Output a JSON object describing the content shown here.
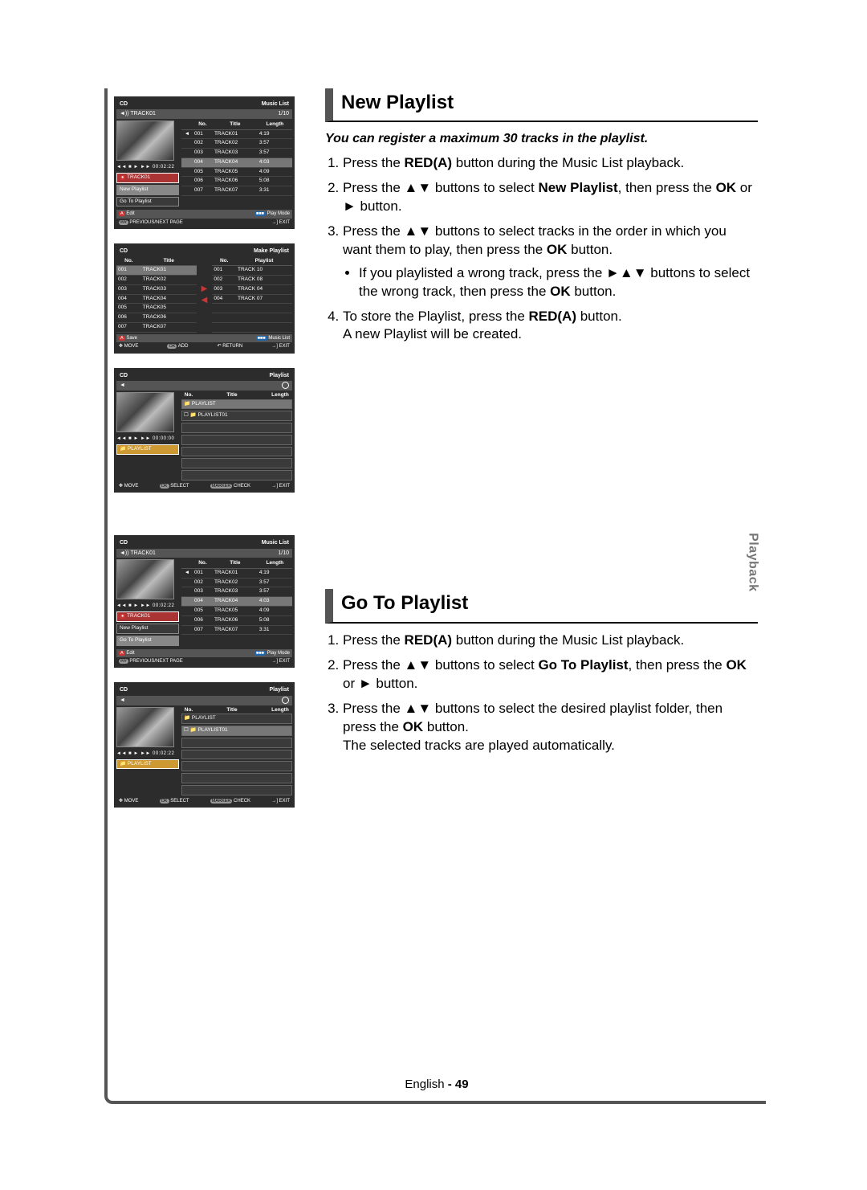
{
  "side_tab": "Playback",
  "footer": {
    "language": "English",
    "dash": " - ",
    "page": "49"
  },
  "section1": {
    "heading": "New Playlist",
    "note": "You can register a maximum 30 tracks in the playlist.",
    "s1_pre": "Press the ",
    "s1_btn": "RED(A)",
    "s1_post": " button during the Music List playback.",
    "s2_pre": "Press the ",
    "s2_arrows": "▲▼",
    "s2_mid": " buttons to select ",
    "s2_target": "New Playlist",
    "s2_mid2": ", then press the ",
    "s2_ok": "OK",
    "s2_or": " or ",
    "s2_play": "►",
    "s2_end": " button.",
    "s3_pre": "Press the ",
    "s3_arrows": "▲▼",
    "s3_mid": " buttons to select tracks in the order in which you want them to play, then press the ",
    "s3_ok": "OK",
    "s3_end": " button.",
    "s3b_pre": "If you playlisted a wrong track, press the ",
    "s3b_arrows": "►▲▼",
    "s3b_mid": " buttons to select the wrong track, then press the ",
    "s3b_ok": "OK",
    "s3b_end": " button.",
    "s4_pre": "To store the Playlist, press the ",
    "s4_btn": "RED(A)",
    "s4_end": " button.",
    "s4_line2": "A new Playlist will be created."
  },
  "section2": {
    "heading": "Go To Playlist",
    "s1_pre": "Press the ",
    "s1_btn": "RED(A)",
    "s1_post": " button during the Music List playback.",
    "s2_pre": "Press the ",
    "s2_arrows": "▲▼",
    "s2_mid": " buttons to select ",
    "s2_target": "Go To Playlist",
    "s2_mid2": ", then press the ",
    "s2_ok": "OK",
    "s2_or": " or ",
    "s2_play": "►",
    "s2_end": " button.",
    "s3_pre": "Press the ",
    "s3_arrows": "▲▼",
    "s3_mid": " buttons to select the desired playlist folder, then press the ",
    "s3_ok": "OK",
    "s3_end": " button.",
    "s3_line2": "The selected tracks are played automatically."
  },
  "shot_musiclist": {
    "title_left": "CD",
    "title_right": "Music List",
    "sub_left": "◄)) TRACK01",
    "sub_right": "1/10",
    "ctl": "◄◄  ■  ►  ►►   00:02:22",
    "btn_current": "TRACK01",
    "opt_new": "New Playlist",
    "opt_goto": "Go To Playlist",
    "th_no": "No.",
    "th_title": "Title",
    "th_len": "Length",
    "tracks": [
      {
        "no": "001",
        "title": "TRACK01",
        "len": "4:19",
        "playing": true
      },
      {
        "no": "002",
        "title": "TRACK02",
        "len": "3:57"
      },
      {
        "no": "003",
        "title": "TRACK03",
        "len": "3:57"
      },
      {
        "no": "004",
        "title": "TRACK04",
        "len": "4:03",
        "hl": true
      },
      {
        "no": "005",
        "title": "TRACK05",
        "len": "4:09"
      },
      {
        "no": "006",
        "title": "TRACK06",
        "len": "5:08"
      },
      {
        "no": "007",
        "title": "TRACK07",
        "len": "3:31"
      }
    ],
    "strip_edit": "Edit",
    "strip_playmode": "Play Mode",
    "strip_prev": "PREVIOUS/NEXT PAGE",
    "strip_exit": "EXIT"
  },
  "shot_makeplaylist": {
    "title_left": "CD",
    "title_right": "Make Playlist",
    "th_no": "No.",
    "th_title": "Title",
    "th_pl": "Playlist",
    "left_rows": [
      {
        "no": "001",
        "title": "TRACK01"
      },
      {
        "no": "002",
        "title": "TRACK02"
      },
      {
        "no": "003",
        "title": "TRACK03"
      },
      {
        "no": "004",
        "title": "TRACK04"
      },
      {
        "no": "005",
        "title": "TRACK05"
      },
      {
        "no": "006",
        "title": "TRACK06"
      },
      {
        "no": "007",
        "title": "TRACK07"
      }
    ],
    "right_rows": [
      {
        "no": "001",
        "title": "TRACK 10"
      },
      {
        "no": "002",
        "title": "TRACK 08"
      },
      {
        "no": "003",
        "title": "TRACK 04"
      },
      {
        "no": "004",
        "title": "TRACK 07"
      }
    ],
    "strip_save": "Save",
    "strip_music": "Music List",
    "strip_move": "MOVE",
    "strip_add": "ADD",
    "strip_return": "RETURN",
    "strip_exit": "EXIT"
  },
  "shot_playlist": {
    "title_left": "CD",
    "title_right": "Playlist",
    "sub_left": "◄",
    "ctl": "◄◄  ■  ►  ►►   00:00:00",
    "btn_current": "PLAYLIST",
    "th_no": "No.",
    "th_title": "Title",
    "th_len": "Length",
    "row_playlist": "PLAYLIST",
    "row_playlist1": "PLAYLIST01",
    "strip_move": "MOVE",
    "strip_select": "SELECT",
    "strip_check": "CHECK",
    "strip_exit": "EXIT"
  },
  "shot_musiclist2": {
    "title_left": "CD",
    "title_right": "Music List",
    "sub_left": "◄)) TRACK01",
    "sub_right": "1/10",
    "ctl": "◄◄  ■  ►  ►►   00:02:22",
    "btn_current": "TRACK01",
    "opt_new": "New Playlist",
    "opt_goto": "Go To Playlist",
    "strip_edit": "Edit",
    "strip_playmode": "Play Mode",
    "strip_prev": "PREVIOUS/NEXT PAGE",
    "strip_exit": "EXIT"
  },
  "shot_playlist2": {
    "title_left": "CD",
    "title_right": "Playlist",
    "sub_left": "◄",
    "ctl": "◄◄  ■  ►  ►►   00:02:22",
    "btn_current": "PLAYLIST",
    "row_playlist": "PLAYLIST",
    "row_playlist1": "PLAYLIST01",
    "strip_move": "MOVE",
    "strip_select": "SELECT",
    "strip_check": "CHECK",
    "strip_exit": "EXIT"
  }
}
